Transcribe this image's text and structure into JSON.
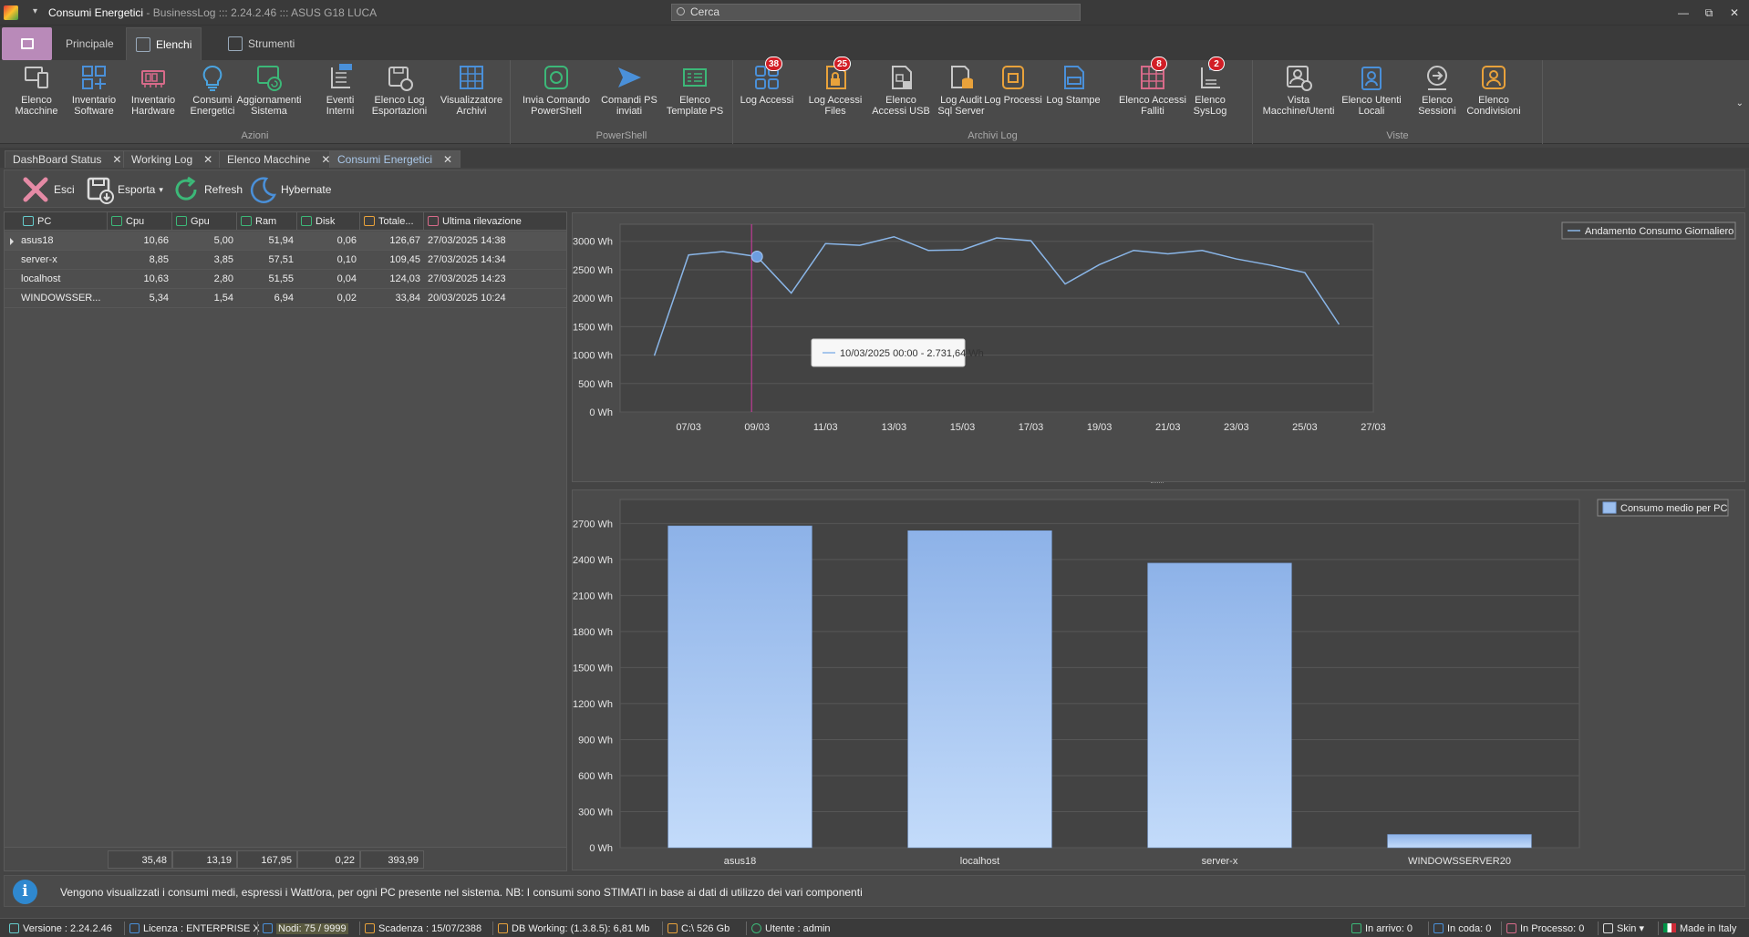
{
  "window": {
    "title": "Consumi Energetici",
    "subtitle": " - BusinessLog ::: 2.24.2.46 ::: ASUS G18 LUCA",
    "search_placeholder": "Cerca",
    "controls": [
      "—",
      "⧉",
      "✕"
    ]
  },
  "ribbon_tabs": [
    {
      "label": "Principale",
      "icon": "home-icon"
    },
    {
      "label": "Elenchi",
      "icon": "list-braces-icon",
      "active": true
    },
    {
      "label": "Strumenti",
      "icon": "tools-icon"
    }
  ],
  "ribbon": {
    "groups": [
      {
        "label": "Azioni",
        "buttons": [
          {
            "label": "Elenco\nMacchine",
            "icon": "computer-icon",
            "color": "#c8c8c8"
          },
          {
            "label": "Inventario\nSoftware",
            "icon": "software-icon",
            "color": "#4a90d9"
          },
          {
            "label": "Inventario\nHardware",
            "icon": "hardware-icon",
            "color": "#d86b8a"
          },
          {
            "label": "Consumi\nEnergetici",
            "icon": "lightbulb-icon",
            "color": "#4aa3df"
          },
          {
            "label": "Aggiornamenti\nSistema",
            "icon": "update-icon",
            "color": "#3cb878"
          },
          {
            "label": "Eventi\nInterni",
            "icon": "log-icon",
            "color": "#c8c8c8"
          },
          {
            "label": "Elenco Log\nEsportazioni",
            "icon": "save-export-icon",
            "color": "#c8c8c8"
          },
          {
            "label": "Visualizzatore\nArchivi",
            "icon": "grid-icon",
            "color": "#4a90d9"
          }
        ]
      },
      {
        "label": "PowerShell",
        "buttons": [
          {
            "label": "Invia Comando\nPowerShell",
            "icon": "powershell-icon",
            "color": "#3cb878"
          },
          {
            "label": "Comandi PS\ninviati",
            "icon": "send-icon",
            "color": "#4a90d9"
          },
          {
            "label": "Elenco\nTemplate PS",
            "icon": "template-icon",
            "color": "#3cb878"
          }
        ]
      },
      {
        "label": "Archivi Log",
        "buttons": [
          {
            "label": "Log Accessi",
            "icon": "access-icon",
            "color": "#4a90d9",
            "badge": "38"
          },
          {
            "label": "Log Accessi\nFiles",
            "icon": "file-lock-icon",
            "color": "#e9a23b",
            "badge": "25"
          },
          {
            "label": "Elenco\nAccessi USB",
            "icon": "usb-lock-icon",
            "color": "#c8c8c8"
          },
          {
            "label": "Log Audit\nSql Server",
            "icon": "database-icon",
            "color": "#e9a23b"
          },
          {
            "label": "Log Processi",
            "icon": "process-icon",
            "color": "#e9a23b"
          },
          {
            "label": "Log Stampe",
            "icon": "printer-icon",
            "color": "#4a90d9"
          },
          {
            "label": "Elenco Accessi\nFalliti",
            "icon": "failed-access-icon",
            "color": "#d86b8a",
            "badge": "8"
          },
          {
            "label": "Elenco\nSysLog",
            "icon": "syslog-icon",
            "color": "#c8c8c8",
            "badge": "2"
          }
        ]
      },
      {
        "label": "Viste",
        "buttons": [
          {
            "label": "Vista\nMacchine/Utenti",
            "icon": "user-machine-icon",
            "color": "#c8c8c8"
          },
          {
            "label": "Elenco Utenti\nLocali",
            "icon": "local-users-icon",
            "color": "#4a90d9"
          },
          {
            "label": "Elenco\nSessioni",
            "icon": "sessions-icon",
            "color": "#c8c8c8"
          },
          {
            "label": "Elenco\nCondivisioni",
            "icon": "share-icon",
            "color": "#e9a23b"
          }
        ]
      }
    ]
  },
  "doc_tabs": [
    {
      "label": "DashBoard Status"
    },
    {
      "label": "Working Log"
    },
    {
      "label": "Elenco Macchine"
    },
    {
      "label": "Consumi Energetici",
      "active": true
    }
  ],
  "toolbar": {
    "exit": "Esci",
    "export": "Esporta",
    "export_arrow": "▾",
    "refresh": "Refresh",
    "hibernate": "Hybernate"
  },
  "grid": {
    "columns": [
      "PC",
      "Cpu",
      "Gpu",
      "Ram",
      "Disk",
      "Totale...",
      "Ultima rilevazione"
    ],
    "rows": [
      {
        "pc": "asus18",
        "cpu": "10,66",
        "gpu": "5,00",
        "ram": "51,94",
        "disk": "0,06",
        "total": "126,67",
        "last": "27/03/2025 14:38"
      },
      {
        "pc": "server-x",
        "cpu": "8,85",
        "gpu": "3,85",
        "ram": "57,51",
        "disk": "0,10",
        "total": "109,45",
        "last": "27/03/2025 14:34"
      },
      {
        "pc": "localhost",
        "cpu": "10,63",
        "gpu": "2,80",
        "ram": "51,55",
        "disk": "0,04",
        "total": "124,03",
        "last": "27/03/2025 14:23"
      },
      {
        "pc": "WINDOWSSER...",
        "cpu": "5,34",
        "gpu": "1,54",
        "ram": "6,94",
        "disk": "0,02",
        "total": "33,84",
        "last": "20/03/2025 10:24"
      }
    ],
    "totals": {
      "cpu": "35,48",
      "gpu": "13,19",
      "ram": "167,95",
      "disk": "0,22",
      "total": "393,99"
    }
  },
  "chart_data": [
    {
      "type": "line",
      "x": [
        "06/03",
        "07/03",
        "08/03",
        "09/03",
        "10/03",
        "11/03",
        "12/03",
        "13/03",
        "14/03",
        "15/03",
        "16/03",
        "17/03",
        "18/03",
        "19/03",
        "20/03",
        "21/03",
        "22/03",
        "23/03",
        "24/03",
        "25/03",
        "26/03",
        "27/03"
      ],
      "x_tick_labels": [
        "07/03",
        "09/03",
        "11/03",
        "13/03",
        "15/03",
        "17/03",
        "19/03",
        "21/03",
        "23/03",
        "25/03",
        "27/03"
      ],
      "series": [
        {
          "name": "Andamento Consumo Giornaliero",
          "values": [
            990,
            2760,
            2820,
            2731.64,
            2090,
            2960,
            2930,
            3080,
            2840,
            2850,
            3060,
            3010,
            2250,
            2590,
            2840,
            2780,
            2840,
            2690,
            2580,
            2450,
            1540
          ]
        }
      ],
      "ylim": [
        0,
        3300
      ],
      "y_tick_labels": [
        "0 Wh",
        "500 Wh",
        "1000 Wh",
        "1500 Wh",
        "2000 Wh",
        "2500 Wh",
        "3000 Wh"
      ],
      "y_ticks": [
        0,
        500,
        1000,
        1500,
        2000,
        2500,
        3000
      ],
      "crosshair_index": 3,
      "tooltip": "10/03/2025 00:00 - 2.731,64 Wh",
      "legend_position": "top-right",
      "color": "#8ab6e8",
      "grid": true
    },
    {
      "type": "bar",
      "categories": [
        "asus18",
        "localhost",
        "server-x",
        "WINDOWSSERVER20"
      ],
      "series": [
        {
          "name": "Consumo medio per PC",
          "values": [
            2680,
            2640,
            2370,
            110
          ]
        }
      ],
      "ylim": [
        0,
        2900
      ],
      "y_tick_labels": [
        "0 Wh",
        "300 Wh",
        "600 Wh",
        "900 Wh",
        "1200 Wh",
        "1500 Wh",
        "1800 Wh",
        "2100 Wh",
        "2400 Wh",
        "2700 Wh"
      ],
      "y_ticks": [
        0,
        300,
        600,
        900,
        1200,
        1500,
        1800,
        2100,
        2400,
        2700
      ],
      "legend_position": "top-right",
      "color": "#9cbfee",
      "grid": true
    }
  ],
  "info": {
    "text": "Vengono visualizzati i consumi medi, espressi i Watt/ora, per ogni PC presente nel sistema. NB: I consumi sono STIMATI in base ai dati di utilizzo dei vari componenti",
    "icon_glyph": "i"
  },
  "status": {
    "version": "Versione : 2.24.2.46",
    "license": "Licenza : ENTERPRISE X",
    "nodes": "Nodi: 75 / 9999",
    "expiry": "Scadenza : 15/07/2388",
    "db": "DB Working: (1.3.8.5): 6,81 Mb",
    "disk": "C:\\ 526 Gb",
    "user": "Utente : admin",
    "incoming": "In arrivo: 0",
    "queue": "In coda: 0",
    "processing": "In Processo: 0",
    "skin": "Skin",
    "made": "Made in Italy"
  },
  "accent_color": "#b98ab9"
}
